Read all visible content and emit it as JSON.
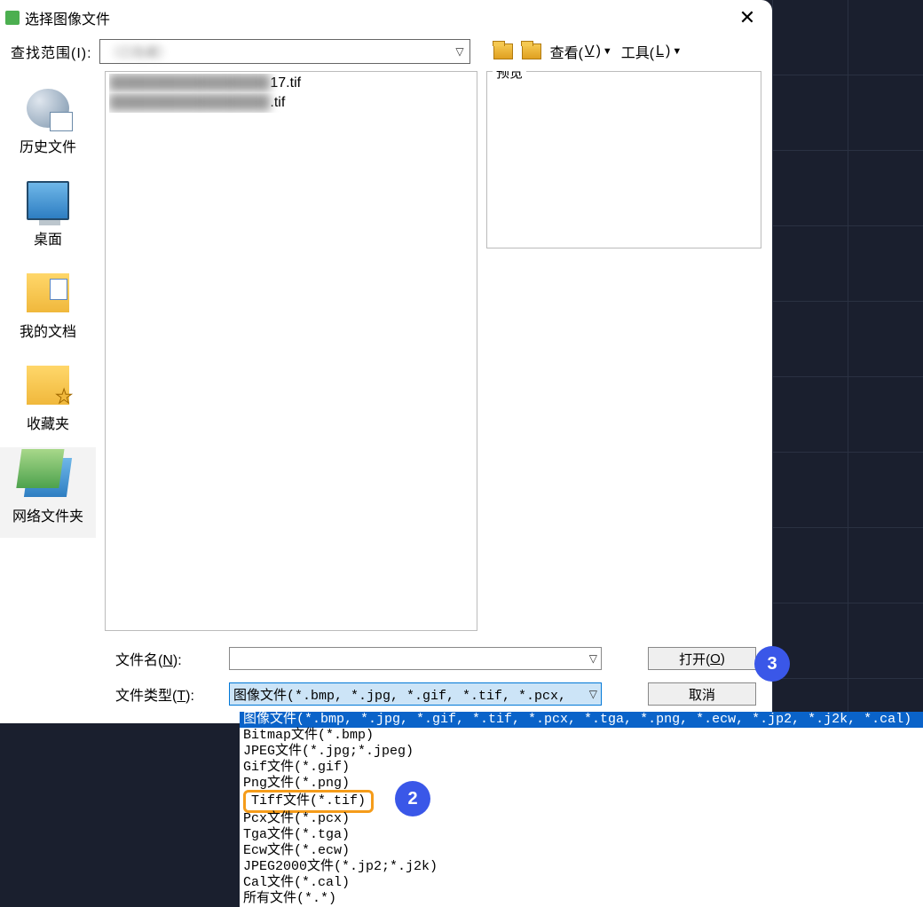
{
  "window": {
    "title": "选择图像文件"
  },
  "search": {
    "label": "查找范围(I):",
    "value_blurred": "（已隐藏）"
  },
  "toolbar": {
    "view_label_prefix": "查看(",
    "view_key": "V",
    "view_label_suffix": ")",
    "tools_label_prefix": "工具(",
    "tools_key": "L",
    "tools_label_suffix": ")"
  },
  "sidebar": [
    {
      "id": "history",
      "label": "历史文件"
    },
    {
      "id": "desktop",
      "label": "桌面"
    },
    {
      "id": "documents",
      "label": "我的文档"
    },
    {
      "id": "favorites",
      "label": "收藏夹"
    },
    {
      "id": "network",
      "label": "网络文件夹"
    }
  ],
  "files": [
    {
      "suffix": "17.tif"
    },
    {
      "suffix": ".tif"
    }
  ],
  "preview": {
    "label": "预览"
  },
  "form": {
    "filename_label_prefix": "文件名(",
    "filename_key": "N",
    "filename_label_suffix": "):",
    "filename_value": "",
    "filetype_label_prefix": "文件类型(",
    "filetype_key": "T",
    "filetype_label_suffix": "):",
    "filetype_selected": "图像文件(*.bmp, *.jpg, *.gif, *.tif, *.pcx,",
    "open_label_prefix": "打开(",
    "open_key": "O",
    "open_label_suffix": ")",
    "cancel_label": "取消"
  },
  "filetype_options": [
    "图像文件(*.bmp, *.jpg, *.gif, *.tif, *.pcx, *.tga, *.png, *.ecw, *.jp2, *.j2k, *.cal)",
    "Bitmap文件(*.bmp)",
    "JPEG文件(*.jpg;*.jpeg)",
    "Gif文件(*.gif)",
    "Png文件(*.png)",
    "Tiff文件(*.tif)",
    "Pcx文件(*.pcx)",
    "Tga文件(*.tga)",
    "Ecw文件(*.ecw)",
    "JPEG2000文件(*.jp2;*.j2k)",
    "Cal文件(*.cal)",
    "所有文件(*.*)"
  ],
  "badges": {
    "b2": "2",
    "b3": "3"
  }
}
